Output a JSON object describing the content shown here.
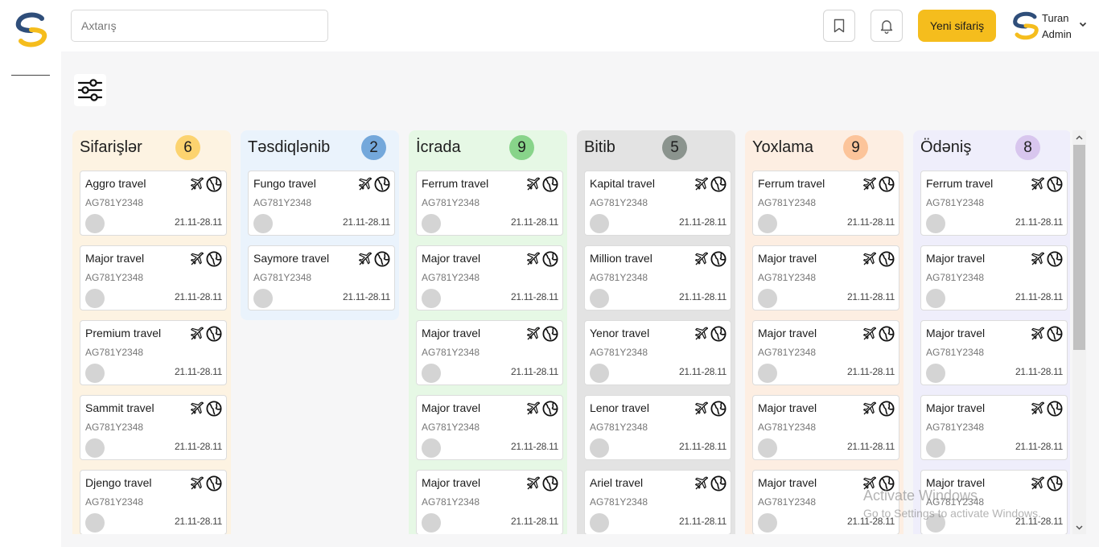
{
  "search": {
    "placeholder": "Axtarış"
  },
  "header": {
    "new_order_label": "Yeni sifariş"
  },
  "user": {
    "name": "Turan",
    "role": "Admin"
  },
  "columns": [
    {
      "title": "Sifarişlər",
      "count": "6",
      "bg": "#fdf3e2",
      "badge": "#fcd36f",
      "cards": [
        {
          "title": "Aggro travel",
          "code": "AG781Y2348",
          "date": "21.11-28.11"
        },
        {
          "title": "Major travel",
          "code": "AG781Y2348",
          "date": "21.11-28.11"
        },
        {
          "title": "Premium travel",
          "code": "AG781Y2348",
          "date": "21.11-28.11"
        },
        {
          "title": "Sammit travel",
          "code": "AG781Y2348",
          "date": "21.11-28.11"
        },
        {
          "title": "Djengo travel",
          "code": "AG781Y2348",
          "date": "21.11-28.11"
        }
      ]
    },
    {
      "title": "Təsdiqlənib",
      "count": "2",
      "bg": "#eaf3fc",
      "badge": "#74a8db",
      "cards": [
        {
          "title": "Fungo travel",
          "code": "AG781Y2348",
          "date": "21.11-28.11"
        },
        {
          "title": "Saymore travel",
          "code": "AG781Y2348",
          "date": "21.11-28.11"
        }
      ]
    },
    {
      "title": "İcrada",
      "count": "9",
      "bg": "#e6f8e5",
      "badge": "#88d48a",
      "cards": [
        {
          "title": "Ferrum travel",
          "code": "AG781Y2348",
          "date": "21.11-28.11"
        },
        {
          "title": "Major travel",
          "code": "AG781Y2348",
          "date": "21.11-28.11"
        },
        {
          "title": "Major travel",
          "code": "AG781Y2348",
          "date": "21.11-28.11"
        },
        {
          "title": "Major travel",
          "code": "AG781Y2348",
          "date": "21.11-28.11"
        },
        {
          "title": "Major travel",
          "code": "AG781Y2348",
          "date": "21.11-28.11"
        }
      ]
    },
    {
      "title": "Bitib",
      "count": "5",
      "bg": "#e3e3e3",
      "badge": "#8b948e",
      "cards": [
        {
          "title": "Kapital travel",
          "code": "AG781Y2348",
          "date": "21.11-28.11"
        },
        {
          "title": "Million travel",
          "code": "AG781Y2348",
          "date": "21.11-28.11"
        },
        {
          "title": "Yenor travel",
          "code": "AG781Y2348",
          "date": "21.11-28.11"
        },
        {
          "title": "Lenor travel",
          "code": "AG781Y2348",
          "date": "21.11-28.11"
        },
        {
          "title": "Ariel travel",
          "code": "AG781Y2348",
          "date": "21.11-28.11"
        }
      ]
    },
    {
      "title": "Yoxlama",
      "count": "9",
      "bg": "#fdeee2",
      "badge": "#fcc49a",
      "cards": [
        {
          "title": "Ferrum travel",
          "code": "AG781Y2348",
          "date": "21.11-28.11"
        },
        {
          "title": "Major travel",
          "code": "AG781Y2348",
          "date": "21.11-28.11"
        },
        {
          "title": "Major travel",
          "code": "AG781Y2348",
          "date": "21.11-28.11"
        },
        {
          "title": "Major travel",
          "code": "AG781Y2348",
          "date": "21.11-28.11"
        },
        {
          "title": "Major travel",
          "code": "AG781Y2348",
          "date": "21.11-28.11"
        }
      ]
    },
    {
      "title": "Ödəniş",
      "count": "8",
      "bg": "#efeefb",
      "badge": "#d8c6ee",
      "cards": [
        {
          "title": "Ferrum travel",
          "code": "AG781Y2348",
          "date": "21.11-28.11"
        },
        {
          "title": "Major travel",
          "code": "AG781Y2348",
          "date": "21.11-28.11"
        },
        {
          "title": "Major travel",
          "code": "AG781Y2348",
          "date": "21.11-28.11"
        },
        {
          "title": "Major travel",
          "code": "AG781Y2348",
          "date": "21.11-28.11"
        },
        {
          "title": "Major travel",
          "code": "AG781Y2348",
          "date": "21.11-28.11"
        }
      ]
    }
  ],
  "watermark": {
    "line1": "Activate Windows",
    "line2": "Go to Settings to activate Windows."
  }
}
